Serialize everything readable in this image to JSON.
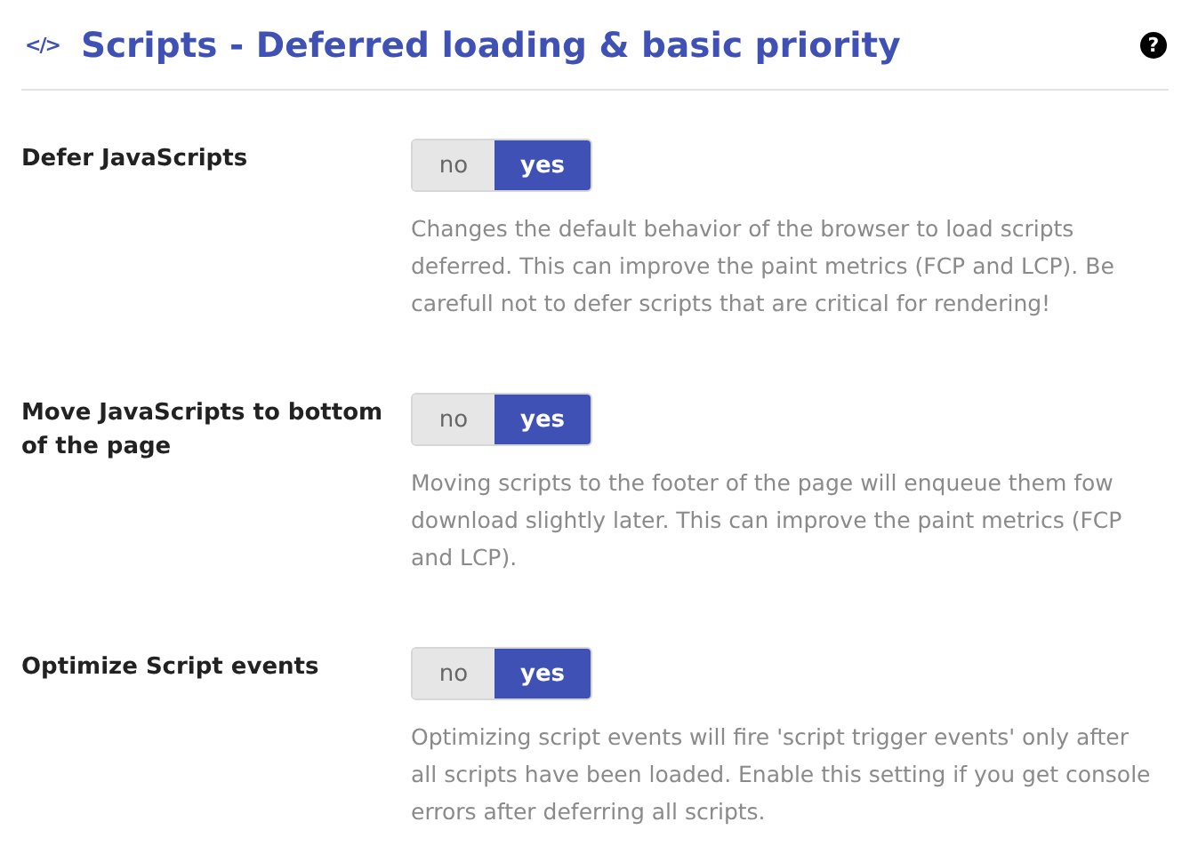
{
  "header": {
    "icon_text": "</>",
    "title": "Scripts - Deferred loading & basic priority",
    "help": "?"
  },
  "settings": [
    {
      "label": "Defer JavaScripts",
      "options": [
        {
          "label": "no",
          "selected": false
        },
        {
          "label": "yes",
          "selected": true
        }
      ],
      "description": "Changes the default behavior of the browser to load scripts deferred. This can improve the paint metrics (FCP and LCP). Be carefull not to defer scripts that are critical for rendering!"
    },
    {
      "label": "Move JavaScripts to bottom of the page",
      "options": [
        {
          "label": "no",
          "selected": false
        },
        {
          "label": "yes",
          "selected": true
        }
      ],
      "description": "Moving scripts to the footer of the page will enqueue them fow download slightly later. This can improve the paint metrics (FCP and LCP)."
    },
    {
      "label": "Optimize Script events",
      "options": [
        {
          "label": "no",
          "selected": false
        },
        {
          "label": "yes",
          "selected": true
        }
      ],
      "description": "Optimizing script events will fire 'script trigger events' only after all scripts have been loaded. Enable this setting if you get console errors after deferring all scripts."
    }
  ]
}
